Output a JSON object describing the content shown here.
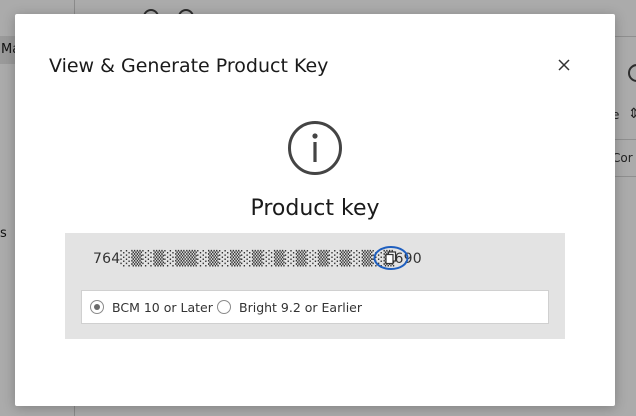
{
  "background": {
    "left_tab_label": "Ma",
    "left_partial_label": "s",
    "right_partial_label_1": "e",
    "right_partial_label_2": "Cor",
    "sort_icon": "sort-icon",
    "search_icon": "search-icon"
  },
  "modal": {
    "title": "View & Generate Product Key",
    "close_icon": "close-icon",
    "info_icon": "info-icon",
    "heading": "Product key",
    "key_value": "764░▒░▒░▒▒░▒░▒░▒░▒░▒░▒░▒░▒░▒690",
    "copy_icon": "copy-icon",
    "options": [
      {
        "label": "BCM 10 or Later",
        "selected": true
      },
      {
        "label": "Bright 9.2 or Earlier",
        "selected": false
      }
    ]
  },
  "colors": {
    "overlay": "#00000055",
    "panel": "#e3e3e3",
    "highlight_ring": "#1f5fbf"
  }
}
